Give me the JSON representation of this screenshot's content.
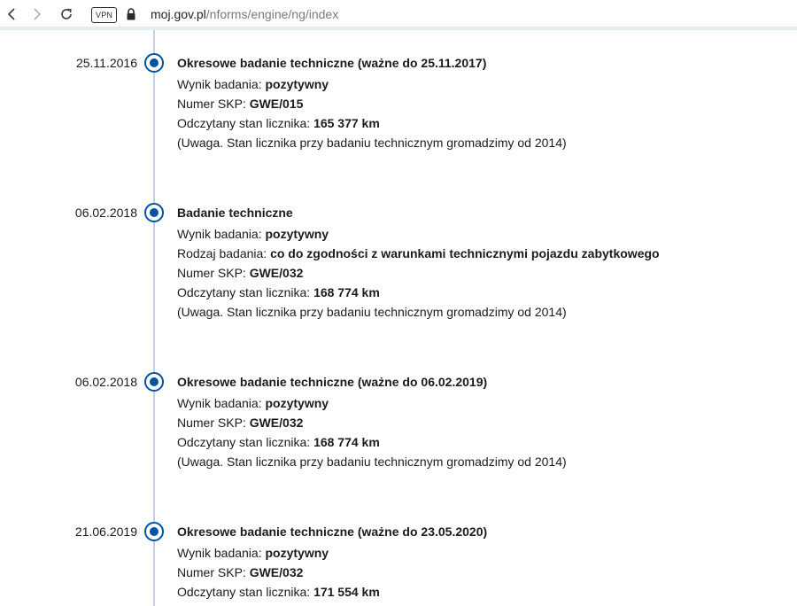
{
  "browser": {
    "vpn_label": "VPN",
    "url_host": "moj.gov.pl",
    "url_path": "/nforms/engine/ng/index"
  },
  "timeline": [
    {
      "date": "25.11.2016",
      "title": "Okresowe badanie techniczne (ważne do 25.11.2017)",
      "details": [
        {
          "label": "Wynik badania: ",
          "value": "pozytywny"
        },
        {
          "label": "Numer SKP: ",
          "value": "GWE/015"
        },
        {
          "label": "Odczytany stan licznika: ",
          "value": "165 377 km"
        },
        {
          "label": "(Uwaga. Stan licznika przy badaniu technicznym gromadzimy od 2014)",
          "value": ""
        }
      ]
    },
    {
      "date": "06.02.2018",
      "title": "Badanie techniczne",
      "details": [
        {
          "label": "Wynik badania: ",
          "value": "pozytywny"
        },
        {
          "label": "Rodzaj badania: ",
          "value": "co do zgodności z warunkami technicznymi pojazdu zabytkowego"
        },
        {
          "label": "Numer SKP: ",
          "value": "GWE/032"
        },
        {
          "label": "Odczytany stan licznika: ",
          "value": "168 774 km"
        },
        {
          "label": "(Uwaga. Stan licznika przy badaniu technicznym gromadzimy od 2014)",
          "value": ""
        }
      ]
    },
    {
      "date": "06.02.2018",
      "title": "Okresowe badanie techniczne (ważne do 06.02.2019)",
      "details": [
        {
          "label": "Wynik badania: ",
          "value": "pozytywny"
        },
        {
          "label": "Numer SKP: ",
          "value": "GWE/032"
        },
        {
          "label": "Odczytany stan licznika: ",
          "value": "168 774 km"
        },
        {
          "label": "(Uwaga. Stan licznika przy badaniu technicznym gromadzimy od 2014)",
          "value": ""
        }
      ]
    },
    {
      "date": "21.06.2019",
      "title": "Okresowe badanie techniczne (ważne do 23.05.2020)",
      "details": [
        {
          "label": "Wynik badania: ",
          "value": "pozytywny"
        },
        {
          "label": "Numer SKP: ",
          "value": "GWE/032"
        },
        {
          "label": "Odczytany stan licznika: ",
          "value": "171 554 km"
        }
      ]
    }
  ]
}
